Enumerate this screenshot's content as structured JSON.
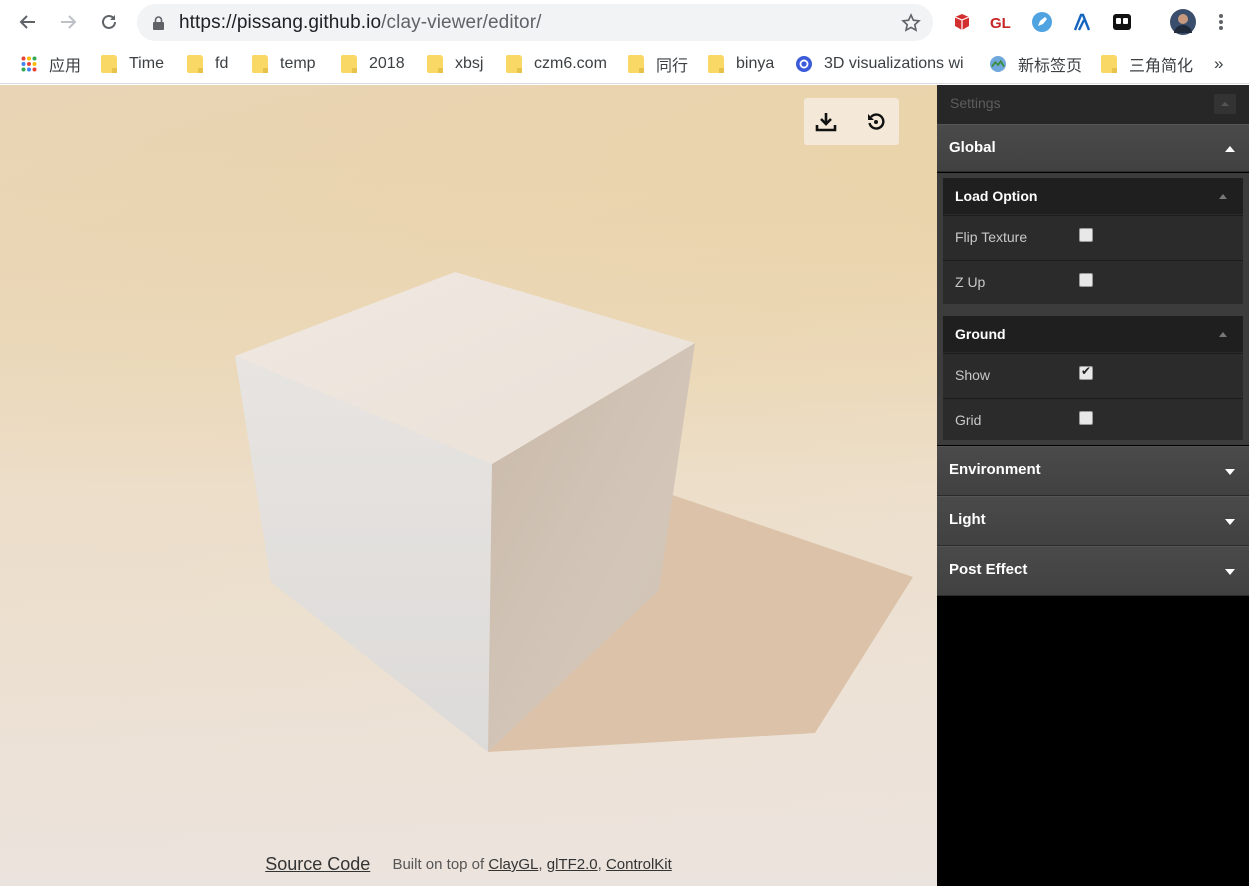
{
  "browser": {
    "url_host": "https://pissang.github.io",
    "url_path": "/clay-viewer/editor/",
    "bookmarks": [
      {
        "label": "应用",
        "icon": "apps-grid-icon"
      },
      {
        "label": "Time",
        "icon": "folder-icon"
      },
      {
        "label": "fd",
        "icon": "folder-icon"
      },
      {
        "label": "temp",
        "icon": "folder-icon"
      },
      {
        "label": "2018",
        "icon": "folder-icon"
      },
      {
        "label": "xbsj",
        "icon": "folder-icon"
      },
      {
        "label": "czm6.com",
        "icon": "folder-icon"
      },
      {
        "label": "同行",
        "icon": "folder-icon"
      },
      {
        "label": "binya",
        "icon": "folder-icon"
      },
      {
        "label": "3D visualizations wi",
        "icon": "site-icon"
      },
      {
        "label": "新标签页",
        "icon": "site-icon"
      },
      {
        "label": "三角简化",
        "icon": "folder-icon"
      }
    ],
    "overflow_label": "»",
    "extensions": [
      "lego-extension-icon",
      "gl-extension-icon",
      "edit-extension-icon",
      "lambda-extension-icon",
      "tab-extension-icon"
    ]
  },
  "viewer": {
    "tools": [
      "download-icon",
      "reset-view-icon"
    ]
  },
  "footer": {
    "source_code": "Source Code",
    "built_on": "Built on top of",
    "links": [
      "ClayGL",
      "glTF2.0",
      "ControlKit"
    ],
    "sep": ","
  },
  "settings": {
    "title": "Settings",
    "sections": {
      "global": {
        "label": "Global",
        "expanded": true
      },
      "environment": {
        "label": "Environment",
        "expanded": false
      },
      "light": {
        "label": "Light",
        "expanded": false
      },
      "post_effect": {
        "label": "Post Effect",
        "expanded": false
      }
    },
    "load_option": {
      "label": "Load Option",
      "rows": [
        {
          "label": "Flip Texture",
          "checked": false
        },
        {
          "label": "Z Up",
          "checked": false
        }
      ]
    },
    "ground": {
      "label": "Ground",
      "rows": [
        {
          "label": "Show",
          "checked": true
        },
        {
          "label": "Grid",
          "checked": false
        }
      ]
    }
  },
  "colors": {
    "panel_bg": "#000000",
    "section_bg": "#444444",
    "folder": "#f9d866"
  }
}
